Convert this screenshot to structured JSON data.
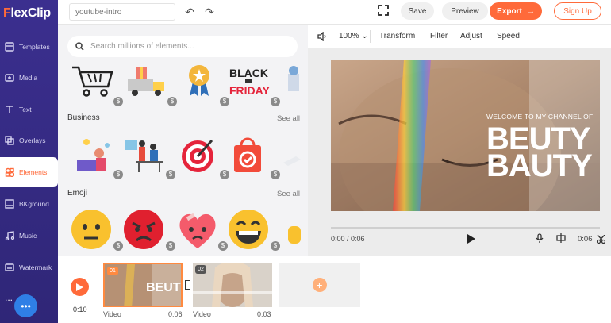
{
  "app": {
    "logo": "FlexClip"
  },
  "sidebar": {
    "items": [
      {
        "label": "Templates",
        "icon": "templates-icon"
      },
      {
        "label": "Media",
        "icon": "media-icon"
      },
      {
        "label": "Text",
        "icon": "text-icon"
      },
      {
        "label": "Overlays",
        "icon": "overlays-icon"
      },
      {
        "label": "Elements",
        "icon": "elements-icon",
        "active": true
      },
      {
        "label": "BKground",
        "icon": "background-icon"
      },
      {
        "label": "Music",
        "icon": "music-icon"
      },
      {
        "label": "Watermark",
        "icon": "watermark-icon"
      }
    ],
    "more": "..."
  },
  "topbar": {
    "project_name": "youtube-intro",
    "save_label": "Save",
    "preview_label": "Preview",
    "export_label": "Export",
    "signup_label": "Sign Up"
  },
  "panel": {
    "search_placeholder": "Search millions of elements...",
    "sections": [
      {
        "title": "Business",
        "see_all": "See all"
      },
      {
        "title": "Emoji",
        "see_all": "See all"
      }
    ]
  },
  "preview_toolbar": {
    "zoom": "100%",
    "transform": "Transform",
    "filter": "Filter",
    "adjust": "Adjust",
    "speed": "Speed"
  },
  "video": {
    "overlay_line": "WELCOME TO MY CHANNEL OF",
    "overlay_title_top": "BEUTY",
    "overlay_title_bottom": "BAUTY"
  },
  "player": {
    "current_time": "0:00 / 0:06",
    "duration": "0:06"
  },
  "timeline": {
    "total_time": "0:10",
    "clips": [
      {
        "num": "01",
        "label": "Video",
        "duration": "0:06"
      },
      {
        "num": "02",
        "label": "Video",
        "duration": "0:03"
      }
    ]
  },
  "colors": {
    "accent": "#ff6a3a",
    "sidebar": "#2f2677"
  }
}
